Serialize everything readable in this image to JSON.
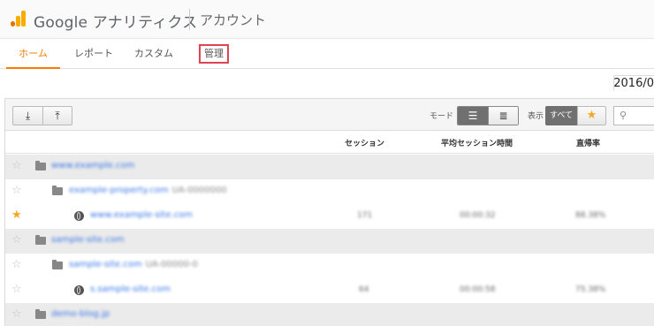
{
  "header": {
    "brand": "Google アナリティクス",
    "account": "アカウント"
  },
  "nav": {
    "tabs": [
      "ホーム",
      "レポート",
      "カスタム",
      "管理"
    ],
    "active": "ホーム",
    "highlighted": "管理"
  },
  "date": "2016/0",
  "toolbar": {
    "expand_icon": "expand-all-icon",
    "collapse_icon": "collapse-all-icon",
    "mode_label": "モード",
    "tree_icon": "tree-view-icon",
    "list_icon": "list-view-icon",
    "show_label": "表示",
    "all_label": "すべて",
    "star_icon": "star-icon",
    "search_icon": "search-icon"
  },
  "columns": {
    "sessions": "セッション",
    "avg_duration": "平均セッション時間",
    "bounce_rate": "直帰率"
  },
  "rows": [
    {
      "type": "account",
      "name": "www.example.com",
      "sub": "",
      "starred": false,
      "sessions": "",
      "duration": "",
      "bounce": ""
    },
    {
      "type": "property",
      "name": "example-property.com",
      "sub": "UA-0000000",
      "starred": false,
      "sessions": "",
      "duration": "",
      "bounce": ""
    },
    {
      "type": "view",
      "name": "www.example-site.com",
      "sub": "",
      "starred": true,
      "sessions": "171",
      "duration": "00:00:32",
      "bounce": "88.38%"
    },
    {
      "type": "account",
      "name": "sample-site.com",
      "sub": "",
      "starred": false,
      "sessions": "",
      "duration": "",
      "bounce": ""
    },
    {
      "type": "property",
      "name": "sample-site.com",
      "sub": "UA-00000-0",
      "starred": false,
      "sessions": "",
      "duration": "",
      "bounce": ""
    },
    {
      "type": "view",
      "name": "s.sample-site.com",
      "sub": "",
      "starred": false,
      "sessions": "64",
      "duration": "00:00:58",
      "bounce": "75.38%"
    },
    {
      "type": "account",
      "name": "demo-blog.jp",
      "sub": "",
      "starred": false,
      "sessions": "",
      "duration": "",
      "bounce": ""
    }
  ],
  "colors": {
    "accent": "#f57c00",
    "highlight_border": "#e0454f",
    "link": "#3b78e7",
    "star": "#f5a623"
  }
}
